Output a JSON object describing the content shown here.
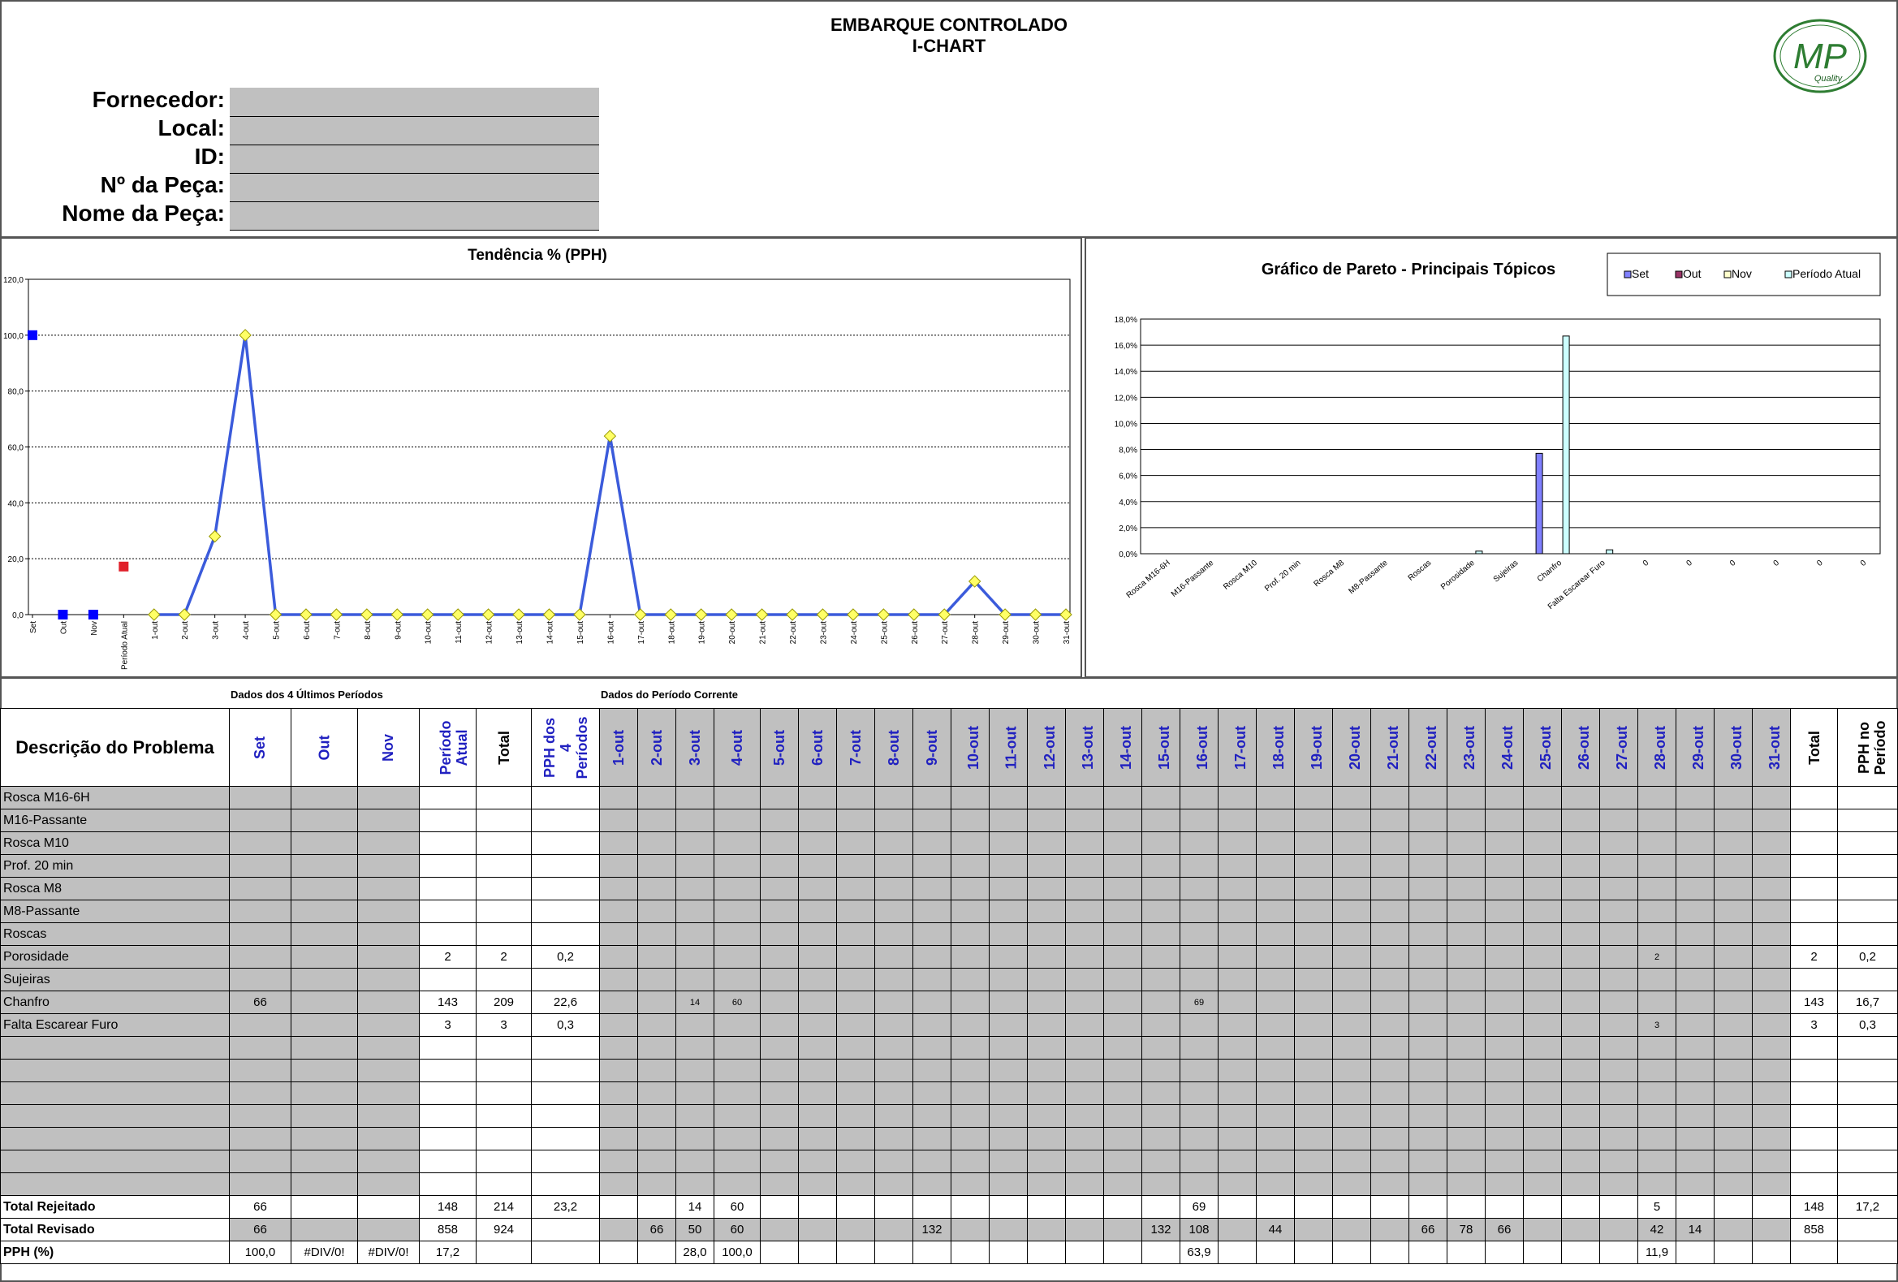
{
  "header": {
    "title1": "EMBARQUE CONTROLADO",
    "title2": "I-CHART",
    "labels": [
      "Fornecedor:",
      "Local:",
      "ID:",
      "Nº da Peça:",
      "Nome da Peça:"
    ],
    "logo_text": "MP",
    "logo_sub": "Quality"
  },
  "trend_chart": {
    "title": "Tendência % (PPH)",
    "ylim": [
      0,
      120
    ],
    "yticks": [
      "0,0",
      "20,0",
      "40,0",
      "60,0",
      "80,0",
      "100,0",
      "120,0"
    ],
    "x_labels": [
      "Set",
      "Out",
      "Nov",
      "Período Atual",
      "1-out",
      "2-out",
      "3-out",
      "4-out",
      "5-out",
      "6-out",
      "7-out",
      "8-out",
      "9-out",
      "10-out",
      "11-out",
      "12-out",
      "13-out",
      "14-out",
      "15-out",
      "16-out",
      "17-out",
      "18-out",
      "19-out",
      "20-out",
      "21-out",
      "22-out",
      "23-out",
      "24-out",
      "25-out",
      "26-out",
      "27-out",
      "28-out",
      "29-out",
      "30-out",
      "31-out"
    ]
  },
  "pareto_chart": {
    "title": "Gráfico de Pareto - Principais  Tópicos",
    "legend": [
      "Set",
      "Out",
      "Nov",
      "Período Atual"
    ],
    "legend_colors": [
      "#8080ff",
      "#993366",
      "#ffffcc",
      "#ccffff"
    ],
    "yticks": [
      "0,0%",
      "2,0%",
      "4,0%",
      "6,0%",
      "8,0%",
      "10,0%",
      "12,0%",
      "14,0%",
      "16,0%",
      "18,0%"
    ],
    "categories": [
      "Rosca M16-6H",
      "M16-Passante",
      "Rosca M10",
      "Prof. 20 min",
      "Rosca M8",
      "M8-Passante",
      "Roscas",
      "Porosidade",
      "Sujeiras",
      "Chanfro",
      "Falta Escarear Furo",
      "0",
      "0",
      "0",
      "0",
      "0",
      "0"
    ]
  },
  "chart_data": [
    {
      "type": "line",
      "title": "Tendência % (PPH)",
      "ylim": [
        0,
        120
      ],
      "categories": [
        "Set",
        "Out",
        "Nov",
        "Período Atual",
        "1-out",
        "2-out",
        "3-out",
        "4-out",
        "5-out",
        "6-out",
        "7-out",
        "8-out",
        "9-out",
        "10-out",
        "11-out",
        "12-out",
        "13-out",
        "14-out",
        "15-out",
        "16-out",
        "17-out",
        "18-out",
        "19-out",
        "20-out",
        "21-out",
        "22-out",
        "23-out",
        "24-out",
        "25-out",
        "26-out",
        "27-out",
        "28-out",
        "29-out",
        "30-out",
        "31-out"
      ],
      "history_points": [
        100.0,
        0,
        0
      ],
      "current_period_point": 17.2,
      "daily_values": [
        0,
        0,
        28.0,
        100.0,
        0,
        0,
        0,
        0,
        0,
        0,
        0,
        0,
        0,
        0,
        0,
        63.9,
        0,
        0,
        0,
        0,
        0,
        0,
        0,
        0,
        0,
        0,
        0,
        11.9,
        0,
        0,
        0
      ],
      "grid": true
    },
    {
      "type": "bar",
      "title": "Gráfico de Pareto - Principais  Tópicos",
      "ylim": [
        0,
        18
      ],
      "categories": [
        "Rosca M16-6H",
        "M16-Passante",
        "Rosca M10",
        "Prof. 20 min",
        "Rosca M8",
        "M8-Passante",
        "Roscas",
        "Porosidade",
        "Sujeiras",
        "Chanfro",
        "Falta Escarear Furo",
        "0",
        "0",
        "0",
        "0",
        "0",
        "0"
      ],
      "series": [
        {
          "name": "Set",
          "values": [
            0,
            0,
            0,
            0,
            0,
            0,
            0,
            0,
            0,
            7.7,
            0,
            0,
            0,
            0,
            0,
            0,
            0
          ]
        },
        {
          "name": "Out",
          "values": [
            0,
            0,
            0,
            0,
            0,
            0,
            0,
            0,
            0,
            0,
            0,
            0,
            0,
            0,
            0,
            0,
            0
          ]
        },
        {
          "name": "Nov",
          "values": [
            0,
            0,
            0,
            0,
            0,
            0,
            0,
            0,
            0,
            0,
            0,
            0,
            0,
            0,
            0,
            0,
            0
          ]
        },
        {
          "name": "Período Atual",
          "values": [
            0,
            0,
            0,
            0,
            0,
            0,
            0,
            0.2,
            0,
            16.7,
            0.3,
            0,
            0,
            0,
            0,
            0,
            0
          ]
        }
      ],
      "legend": "top-right",
      "grid": true
    }
  ],
  "table": {
    "section_hist": "Dados dos 4 Últimos Períodos",
    "section_curr": "Dados do Período Corrente",
    "desc_header": "Descrição do Problema",
    "hist_headers": [
      "Set",
      "Out",
      "Nov",
      "Período Atual",
      "Total",
      "PPH dos 4 Períodos"
    ],
    "days": [
      "1-out",
      "2-out",
      "3-out",
      "4-out",
      "5-out",
      "6-out",
      "7-out",
      "8-out",
      "9-out",
      "10-out",
      "11-out",
      "12-out",
      "13-out",
      "14-out",
      "15-out",
      "16-out",
      "17-out",
      "18-out",
      "19-out",
      "20-out",
      "21-out",
      "22-out",
      "23-out",
      "24-out",
      "25-out",
      "26-out",
      "27-out",
      "28-out",
      "29-out",
      "30-out",
      "31-out"
    ],
    "end_headers": [
      "Total",
      "PPH no Período"
    ],
    "rows": [
      {
        "label": "Rosca M16-6H",
        "hist": [
          "",
          "",
          "",
          "",
          "",
          ""
        ],
        "days": {},
        "end": [
          "",
          ""
        ]
      },
      {
        "label": "M16-Passante",
        "hist": [
          "",
          "",
          "",
          "",
          "",
          ""
        ],
        "days": {},
        "end": [
          "",
          ""
        ]
      },
      {
        "label": "Rosca M10",
        "hist": [
          "",
          "",
          "",
          "",
          "",
          ""
        ],
        "days": {},
        "end": [
          "",
          ""
        ]
      },
      {
        "label": "Prof. 20 min",
        "hist": [
          "",
          "",
          "",
          "",
          "",
          ""
        ],
        "days": {},
        "end": [
          "",
          ""
        ]
      },
      {
        "label": "Rosca M8",
        "hist": [
          "",
          "",
          "",
          "",
          "",
          ""
        ],
        "days": {},
        "end": [
          "",
          ""
        ]
      },
      {
        "label": "M8-Passante",
        "hist": [
          "",
          "",
          "",
          "",
          "",
          ""
        ],
        "days": {},
        "end": [
          "",
          ""
        ]
      },
      {
        "label": "Roscas",
        "hist": [
          "",
          "",
          "",
          "",
          "",
          ""
        ],
        "days": {},
        "end": [
          "",
          ""
        ]
      },
      {
        "label": "Porosidade",
        "hist": [
          "",
          "",
          "",
          "2",
          "2",
          "0,2"
        ],
        "days": {
          "27": "2"
        },
        "end": [
          "2",
          "0,2"
        ]
      },
      {
        "label": "Sujeiras",
        "hist": [
          "",
          "",
          "",
          "",
          "",
          ""
        ],
        "days": {},
        "end": [
          "",
          ""
        ]
      },
      {
        "label": "Chanfro",
        "hist": [
          "66",
          "",
          "",
          "143",
          "209",
          "22,6"
        ],
        "days": {
          "2": "14",
          "3": "60",
          "15": "69"
        },
        "end": [
          "143",
          "16,7"
        ]
      },
      {
        "label": "Falta Escarear Furo",
        "hist": [
          "",
          "",
          "",
          "3",
          "3",
          "0,3"
        ],
        "days": {
          "27": "3"
        },
        "end": [
          "3",
          "0,3"
        ]
      },
      {
        "label": "",
        "hist": [
          "",
          "",
          "",
          "",
          "",
          ""
        ],
        "days": {},
        "end": [
          "",
          ""
        ]
      },
      {
        "label": "",
        "hist": [
          "",
          "",
          "",
          "",
          "",
          ""
        ],
        "days": {},
        "end": [
          "",
          ""
        ]
      },
      {
        "label": "",
        "hist": [
          "",
          "",
          "",
          "",
          "",
          ""
        ],
        "days": {},
        "end": [
          "",
          ""
        ]
      },
      {
        "label": "",
        "hist": [
          "",
          "",
          "",
          "",
          "",
          ""
        ],
        "days": {},
        "end": [
          "",
          ""
        ]
      },
      {
        "label": "",
        "hist": [
          "",
          "",
          "",
          "",
          "",
          ""
        ],
        "days": {},
        "end": [
          "",
          ""
        ]
      },
      {
        "label": "",
        "hist": [
          "",
          "",
          "",
          "",
          "",
          ""
        ],
        "days": {},
        "end": [
          "",
          ""
        ]
      },
      {
        "label": "",
        "hist": [
          "",
          "",
          "",
          "",
          "",
          ""
        ],
        "days": {},
        "end": [
          "",
          ""
        ]
      }
    ],
    "total_rejeitado": {
      "label": "Total Rejeitado",
      "hist": [
        "66",
        "",
        "",
        "148",
        "214",
        "23,2"
      ],
      "days": {
        "2": "14",
        "3": "60",
        "15": "69",
        "27": "5"
      },
      "end": [
        "148",
        "17,2"
      ]
    },
    "total_revisado": {
      "label": "Total Revisado",
      "hist": [
        "66",
        "",
        "",
        "858",
        "924",
        ""
      ],
      "days": {
        "1": "66",
        "2": "50",
        "3": "60",
        "8": "132",
        "14": "132",
        "15": "108",
        "17": "44",
        "21": "66",
        "22": "78",
        "23": "66",
        "27": "42",
        "28": "14"
      },
      "end": [
        "858",
        ""
      ]
    },
    "pph": {
      "label": "PPH (%)",
      "hist": [
        "100,0",
        "#DIV/0!",
        "#DIV/0!",
        "17,2",
        "",
        ""
      ],
      "days": {
        "2": "28,0",
        "3": "100,0",
        "15": "63,9",
        "27": "11,9"
      },
      "end": [
        "",
        ""
      ]
    }
  }
}
